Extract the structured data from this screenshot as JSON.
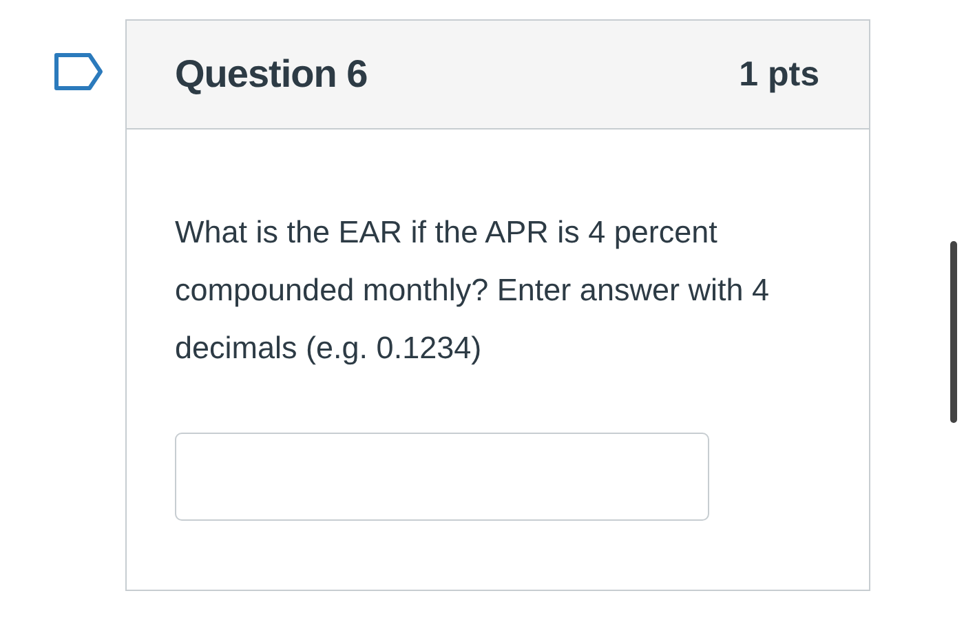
{
  "question": {
    "title": "Question 6",
    "points": "1 pts",
    "flagged": false,
    "text": "What is the EAR if the APR is 4 percent compounded monthly? Enter answer with 4 decimals (e.g. 0.1234)"
  }
}
